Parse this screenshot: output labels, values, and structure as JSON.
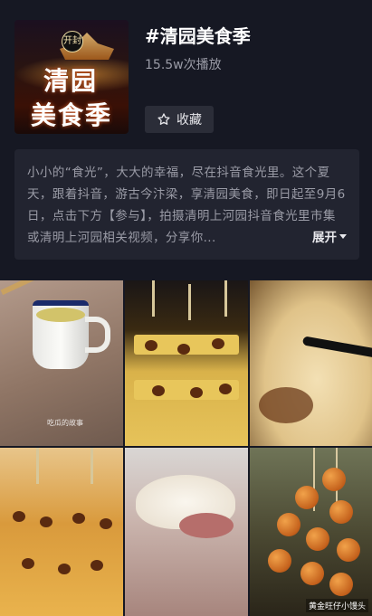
{
  "header": {
    "cover": {
      "seal_text": "开封",
      "line1": "清园",
      "line2": "美食季"
    },
    "title": "#清园美食季",
    "plays": "15.5w次播放",
    "favorite_label": "收藏"
  },
  "description": {
    "text": "小小的“食光”，大大的幸福，尽在抖音食光里。这个夏天，跟着抖音，游古今汴梁，享清园美食，即日起至9月6日，点击下方【参与】，拍摄清明上河园抖音食光里市集或清明上河园相关视频，分享你...",
    "expand_label": "展开"
  },
  "videos": [
    {
      "id": "tea",
      "caption": "吃瓜的故事"
    },
    {
      "id": "date-cake",
      "caption": ""
    },
    {
      "id": "bun",
      "caption": ""
    },
    {
      "id": "date-cake-2",
      "caption": ""
    },
    {
      "id": "dumpling",
      "caption": ""
    },
    {
      "id": "skewers",
      "caption": "黄金旺仔小馒头"
    }
  ],
  "colors": {
    "background": "#161823",
    "panel": "#222430",
    "muted_text": "#9a9ba6"
  }
}
